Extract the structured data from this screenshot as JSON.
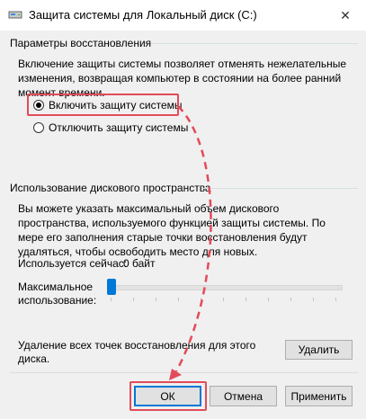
{
  "window": {
    "title": "Защита системы для Локальный диск (C:)",
    "close_glyph": "✕"
  },
  "restore_settings": {
    "group_title": "Параметры восстановления",
    "description": "Включение защиты системы позволяет отменять нежелательные изменения, возвращая компьютер в состоянии на более ранний момент времени.",
    "options": [
      {
        "label": "Включить защиту системы",
        "selected": true
      },
      {
        "label": "Отключить защиту системы",
        "selected": false
      }
    ]
  },
  "disk_usage": {
    "group_title": "Использование дискового пространства",
    "description": "Вы можете указать максимальный объем дискового пространства, используемого функцией защиты системы. По мере его заполнения старые точки восстановления будут удаляться, чтобы освободить место для новых.",
    "current_usage_label": "Используется сейчас:",
    "current_usage_value": "0 байт",
    "max_usage_label_line1": "Максимальное",
    "max_usage_label_line2": "использование:",
    "max_usage_fraction": 0
  },
  "delete_points": {
    "text_line1": "Удаление всех точек восстановления для этого",
    "text_line2": "диска.",
    "button_label": "Удалить"
  },
  "footer": {
    "ok_label": "ОК",
    "cancel_label": "Отмена",
    "apply_label": "Применить"
  },
  "colors": {
    "highlight": "#e24b5a",
    "accent": "#0078d7"
  }
}
